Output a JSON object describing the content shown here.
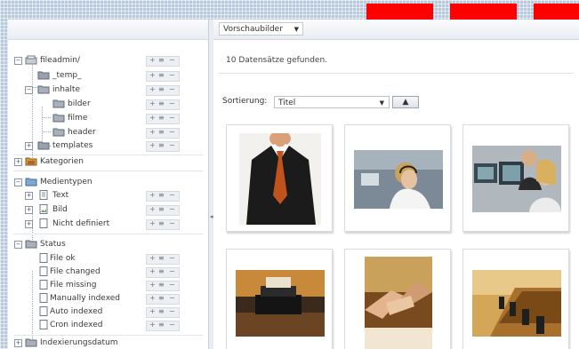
{
  "tree": {
    "fileadmin": {
      "label": "fileadmin/",
      "children": [
        "_temp_",
        "inhalte",
        "bilder",
        "filme",
        "header",
        "templates"
      ]
    },
    "kategorien": "Kategorien",
    "medientypen": {
      "label": "Medientypen",
      "children": [
        "Text",
        "Bild",
        "Nicht definiert"
      ]
    },
    "status": {
      "label": "Status",
      "children": [
        "File ok",
        "File changed",
        "File missing",
        "Manually indexed",
        "Auto indexed",
        "Cron indexed"
      ]
    },
    "indexierungsdatum": "Indexierungsdatum"
  },
  "toolbar": {
    "view_select": "Vorschaubilder"
  },
  "results": {
    "count_text": "10 Datensätze gefunden."
  },
  "sorting": {
    "label": "Sortierung:",
    "value": "Titel"
  },
  "colors": {
    "accent_red": "#ff0000",
    "panel_bg": "#b8c9dd"
  },
  "thumbnails": [
    {
      "icon": "business-suit-photo"
    },
    {
      "icon": "call-center-headset-photo"
    },
    {
      "icon": "call-center-team-photo"
    },
    {
      "icon": "vintage-typewriter-photo"
    },
    {
      "icon": "handshake-photo"
    },
    {
      "icon": "conference-table-photo"
    }
  ]
}
